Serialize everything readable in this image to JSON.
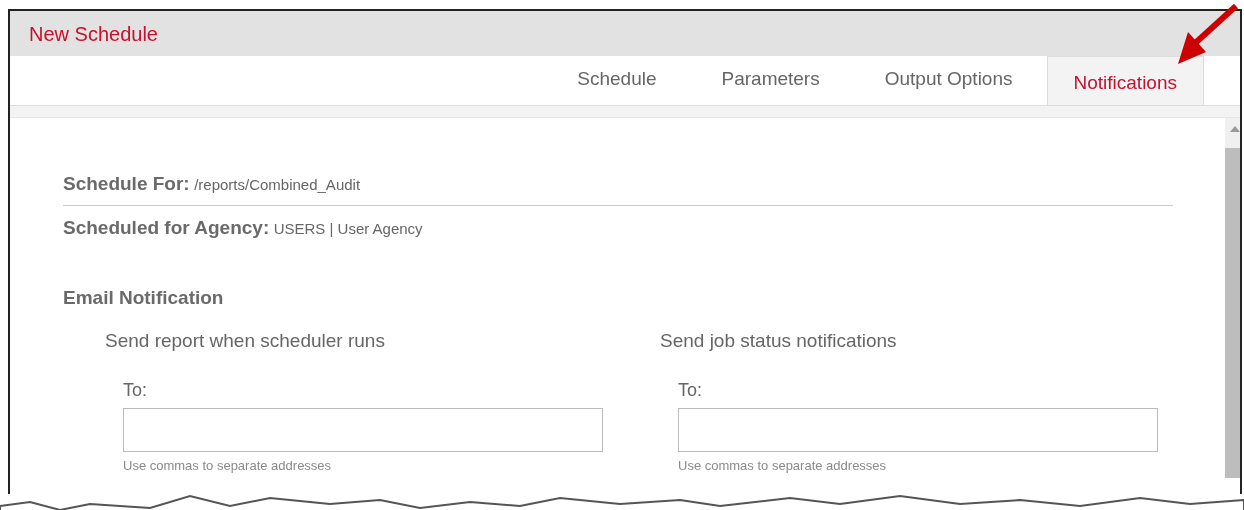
{
  "window": {
    "title": "New Schedule"
  },
  "tabs": [
    {
      "label": "Schedule",
      "selected": false
    },
    {
      "label": "Parameters",
      "selected": false
    },
    {
      "label": "Output Options",
      "selected": false
    },
    {
      "label": "Notifications",
      "selected": true
    }
  ],
  "schedule_for": {
    "label": "Schedule For:",
    "value": "/reports/Combined_Audit"
  },
  "agency": {
    "label": "Scheduled for Agency:",
    "value": "USERS | User Agency"
  },
  "email_notification": {
    "heading": "Email Notification",
    "sections": [
      {
        "heading": "Send report when scheduler runs",
        "to_label": "To:",
        "hint": "Use commas to separate addresses"
      },
      {
        "heading": "Send job status notifications",
        "to_label": "To:",
        "hint": "Use commas to separate addresses"
      }
    ]
  }
}
